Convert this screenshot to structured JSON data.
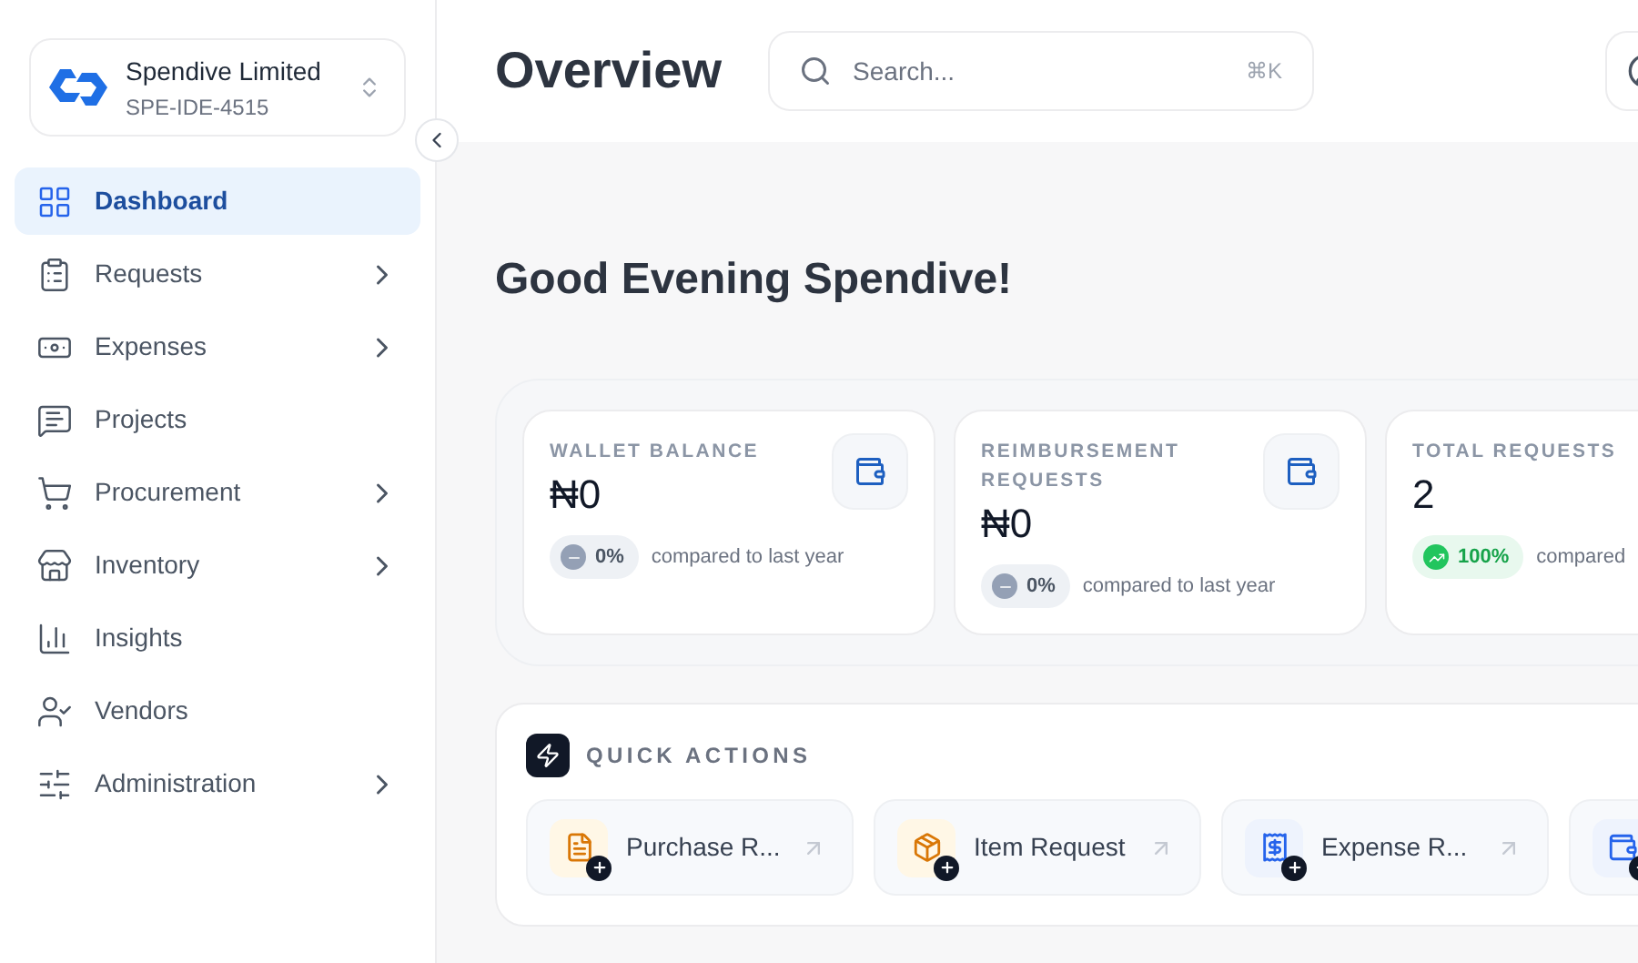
{
  "org": {
    "name": "Spendive Limited",
    "code": "SPE-IDE-4515"
  },
  "sidebar": {
    "items": [
      {
        "kind": "dashboard",
        "label": "Dashboard",
        "selected": true,
        "expandable": false
      },
      {
        "kind": "requests",
        "label": "Requests",
        "selected": false,
        "expandable": true
      },
      {
        "kind": "expenses",
        "label": "Expenses",
        "selected": false,
        "expandable": true
      },
      {
        "kind": "projects",
        "label": "Projects",
        "selected": false,
        "expandable": false
      },
      {
        "kind": "procurement",
        "label": "Procurement",
        "selected": false,
        "expandable": true
      },
      {
        "kind": "inventory",
        "label": "Inventory",
        "selected": false,
        "expandable": true
      },
      {
        "kind": "insights",
        "label": "Insights",
        "selected": false,
        "expandable": false
      },
      {
        "kind": "vendors",
        "label": "Vendors",
        "selected": false,
        "expandable": false
      },
      {
        "kind": "administration",
        "label": "Administration",
        "selected": false,
        "expandable": true
      }
    ]
  },
  "header": {
    "title": "Overview",
    "search": {
      "placeholder": "Search...",
      "shortcut": "⌘K"
    }
  },
  "greeting": "Good Evening Spendive!",
  "stats": [
    {
      "label": "WALLET BALANCE",
      "value": "₦0",
      "kind": "flat",
      "change": "0%",
      "note": "compared to last year"
    },
    {
      "label": "REIMBURSEMENT REQUESTS",
      "value": "₦0",
      "kind": "flat",
      "change": "0%",
      "note": "compared to last year"
    },
    {
      "label": "TOTAL REQUESTS",
      "value": "2",
      "kind": "up",
      "change": "100%",
      "note": "compared"
    }
  ],
  "quick_actions": {
    "title": "QUICK ACTIONS",
    "items": [
      {
        "kind": "document",
        "label": "Purchase R..."
      },
      {
        "kind": "package",
        "label": "Item Request"
      },
      {
        "kind": "receipt",
        "label": "Expense R..."
      },
      {
        "kind": "wallet"
      }
    ]
  }
}
